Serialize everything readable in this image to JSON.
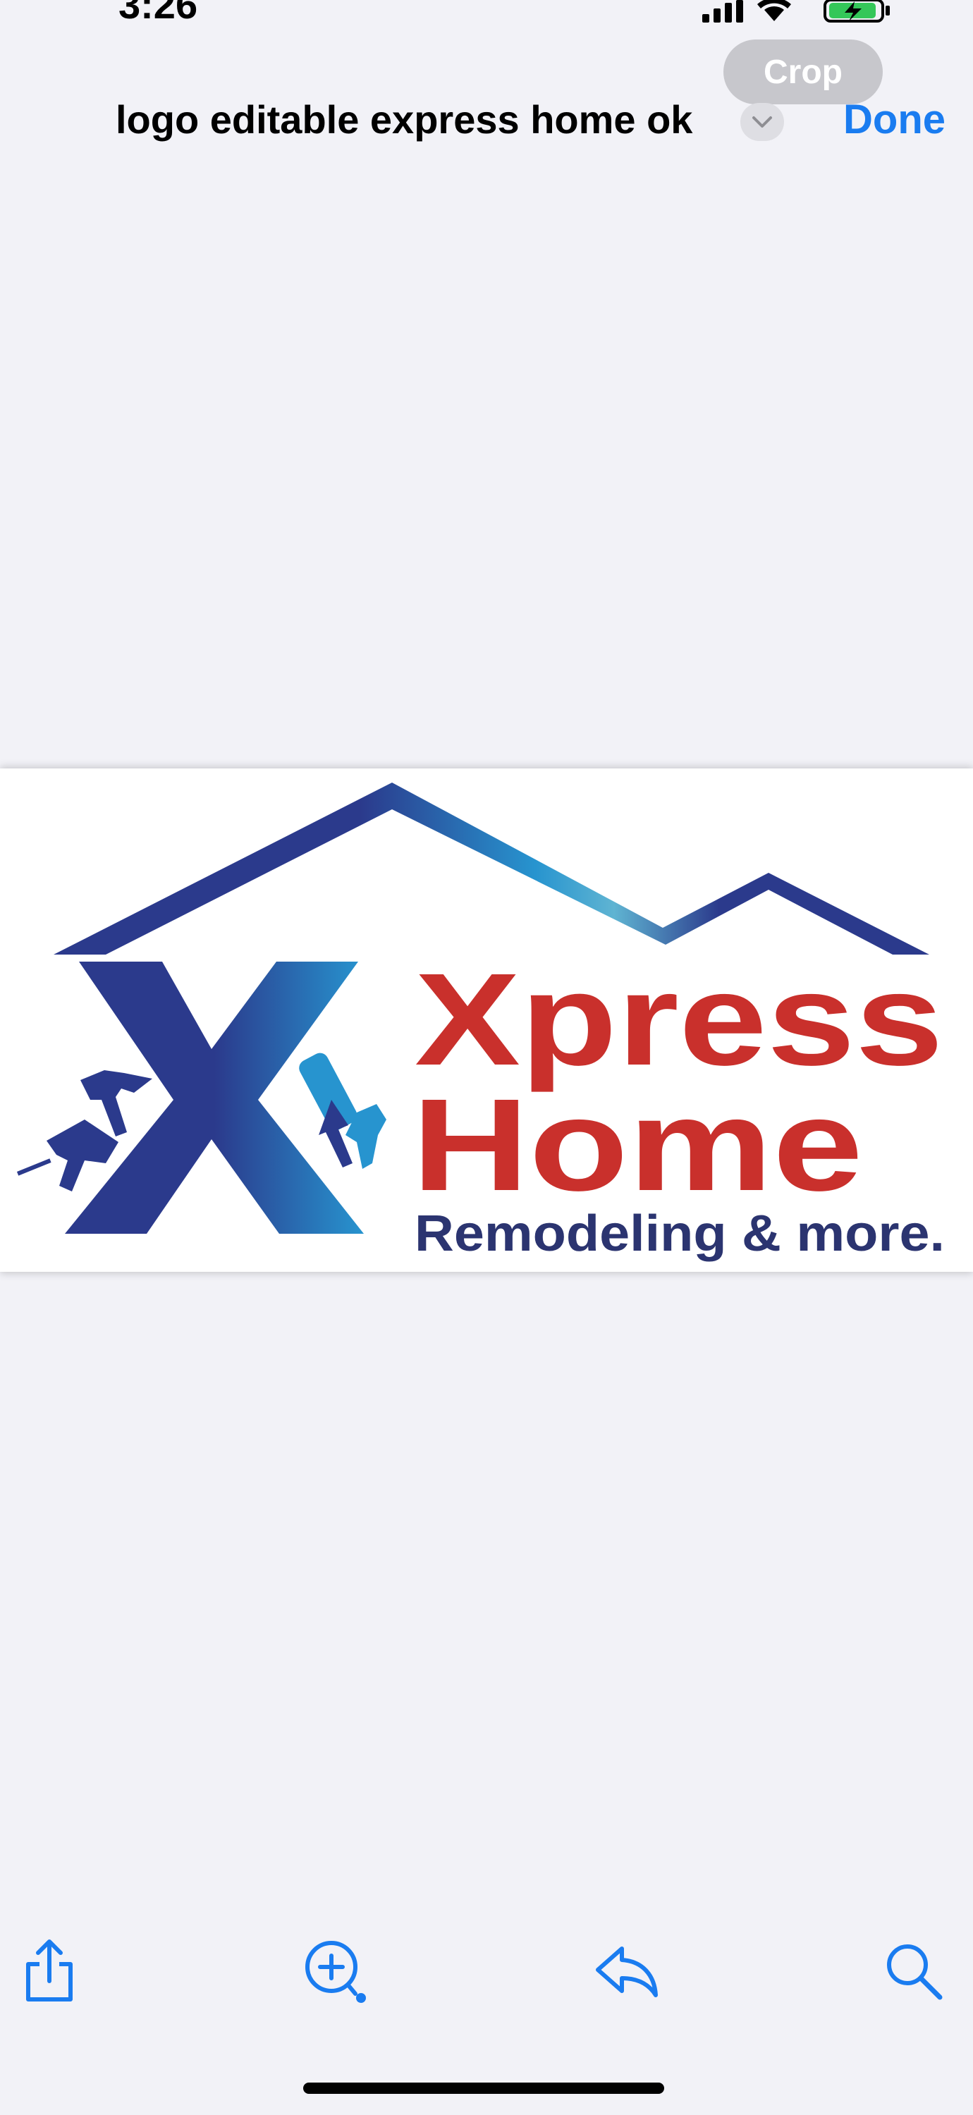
{
  "status_bar": {
    "time": "3:26"
  },
  "toolbar": {
    "crop_label": "Crop",
    "done_label": "Done"
  },
  "document": {
    "title": "logo editable express home ok"
  },
  "logo": {
    "line1": "Xpress",
    "line2": "Home",
    "tagline": "Remodeling & more.",
    "colors": {
      "red": "#c9302c",
      "navy": "#2b3a8c",
      "blue": "#2794cf",
      "dark_text": "#2b3470"
    }
  },
  "bottom_toolbar": {
    "icons": [
      "share-icon",
      "markup-icon",
      "reply-icon",
      "search-icon"
    ],
    "accent": "#1a7cf0"
  }
}
